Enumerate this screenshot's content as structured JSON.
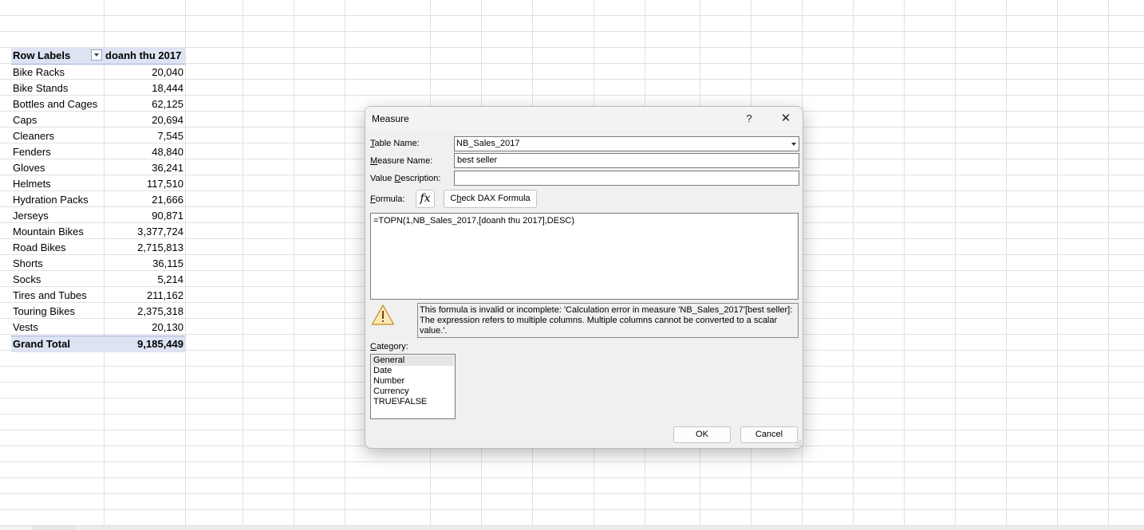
{
  "pivot": {
    "header": {
      "label": "Row Labels",
      "value": "doanh thu 2017"
    },
    "rows": [
      {
        "label": "Bike Racks",
        "value": "20,040"
      },
      {
        "label": "Bike Stands",
        "value": "18,444"
      },
      {
        "label": "Bottles and Cages",
        "value": "62,125"
      },
      {
        "label": "Caps",
        "value": "20,694"
      },
      {
        "label": "Cleaners",
        "value": "7,545"
      },
      {
        "label": "Fenders",
        "value": "48,840"
      },
      {
        "label": "Gloves",
        "value": "36,241"
      },
      {
        "label": "Helmets",
        "value": "117,510"
      },
      {
        "label": "Hydration Packs",
        "value": "21,666"
      },
      {
        "label": "Jerseys",
        "value": "90,871"
      },
      {
        "label": "Mountain Bikes",
        "value": "3,377,724"
      },
      {
        "label": "Road Bikes",
        "value": "2,715,813"
      },
      {
        "label": "Shorts",
        "value": "36,115"
      },
      {
        "label": "Socks",
        "value": "5,214"
      },
      {
        "label": "Tires and Tubes",
        "value": "211,162"
      },
      {
        "label": "Touring Bikes",
        "value": "2,375,318"
      },
      {
        "label": "Vests",
        "value": "20,130"
      }
    ],
    "grand_total": {
      "label": "Grand Total",
      "value": "9,185,449"
    }
  },
  "dialog": {
    "title": "Measure",
    "help_glyph": "?",
    "close_glyph": "✕",
    "table_name": {
      "label_key": "T",
      "label_rest": "able Name:",
      "value": "NB_Sales_2017"
    },
    "measure_name": {
      "label_key": "M",
      "label_rest": "easure Name:",
      "value": "best seller"
    },
    "value_description": {
      "label_pre": "Value ",
      "label_key": "D",
      "label_rest": "escription:",
      "value": ""
    },
    "formula": {
      "label_key": "F",
      "label_rest": "ormula:",
      "fx_glyph": "fx",
      "check_pre": "C",
      "check_key": "h",
      "check_rest": "eck DAX Formula",
      "text": "=TOPN(1,NB_Sales_2017,[doanh thu 2017],DESC)"
    },
    "error_message": "This formula is invalid or incomplete: 'Calculation error in measure 'NB_Sales_2017'[best seller]: The expression refers to multiple columns. Multiple columns cannot be converted to a scalar value.'.",
    "category": {
      "label_key": "C",
      "label_rest": "ategory:",
      "items": [
        "General",
        "Date",
        "Number",
        "Currency",
        "TRUE\\FALSE"
      ],
      "selected": "General"
    },
    "ok_label": "OK",
    "cancel_label": "Cancel"
  }
}
